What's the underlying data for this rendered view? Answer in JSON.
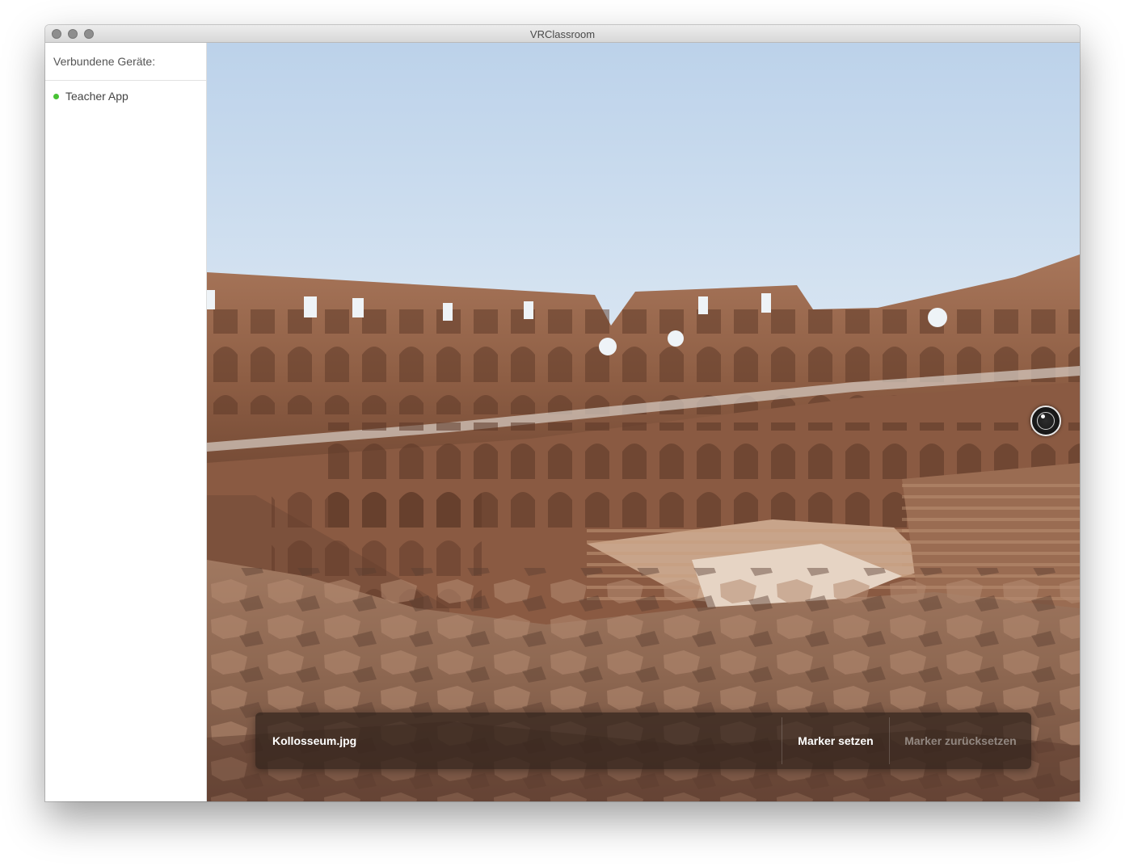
{
  "window": {
    "title": "VRClassroom"
  },
  "sidebar": {
    "header": "Verbundene Geräte:",
    "devices": [
      {
        "name": "Teacher App",
        "status": "connected",
        "status_color": "#47c234"
      }
    ]
  },
  "viewer": {
    "image_name": "Kollosseum.jpg",
    "gaze_marker_icon": "eye-marker-icon"
  },
  "toolbar": {
    "set_marker_label": "Marker setzen",
    "reset_marker_label": "Marker zurücksetzen"
  }
}
